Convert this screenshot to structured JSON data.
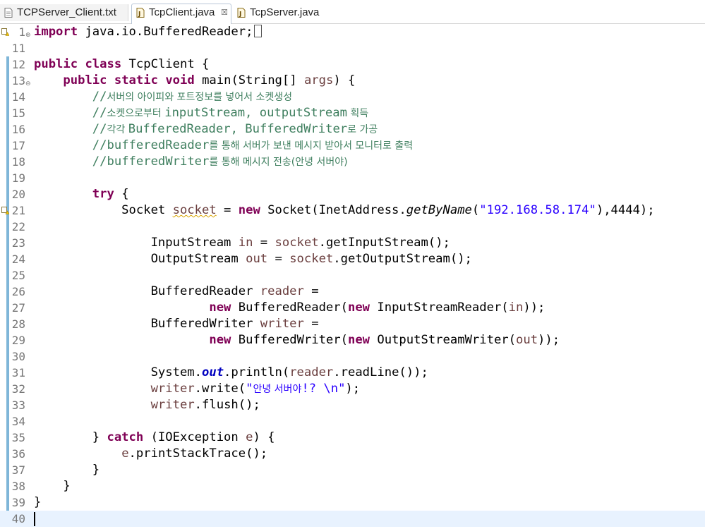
{
  "tabs": [
    {
      "label": "TCPServer_Client.txt",
      "icon": "text-file-icon",
      "active": false
    },
    {
      "label": "TcpClient.java",
      "icon": "java-file-icon",
      "active": true,
      "close": "☒"
    },
    {
      "label": "TcpServer.java",
      "icon": "java-file-icon",
      "active": false
    }
  ],
  "colors": {
    "keyword": "#7f0055",
    "comment": "#3f7f5f",
    "string": "#2a00ff",
    "local_var": "#6a3e3e",
    "field": "#0000c0",
    "current_line": "#e8f2fe",
    "quick_diff": "#7fb6d8"
  },
  "editor": {
    "lines": [
      {
        "n": "1",
        "fold": "⊕",
        "marker": "warning",
        "segs": [
          {
            "c": "kw",
            "t": "import"
          },
          {
            "c": "",
            "t": " java.io.BufferedReader;"
          }
        ],
        "box": true
      },
      {
        "n": "11",
        "segs": []
      },
      {
        "n": "12",
        "segs": [
          {
            "c": "kw",
            "t": "public"
          },
          {
            "c": "",
            "t": " "
          },
          {
            "c": "kw",
            "t": "class"
          },
          {
            "c": "",
            "t": " TcpClient {"
          }
        ]
      },
      {
        "n": "13",
        "fold": "⊖",
        "segs": [
          {
            "c": "",
            "t": "    "
          },
          {
            "c": "kw",
            "t": "public"
          },
          {
            "c": "",
            "t": " "
          },
          {
            "c": "kw",
            "t": "static"
          },
          {
            "c": "",
            "t": " "
          },
          {
            "c": "kw",
            "t": "void"
          },
          {
            "c": "",
            "t": " main(String[] "
          },
          {
            "c": "lv",
            "t": "args"
          },
          {
            "c": "",
            "t": ") {"
          }
        ]
      },
      {
        "n": "14",
        "segs": [
          {
            "c": "",
            "t": "        "
          },
          {
            "c": "cm",
            "t": "//"
          },
          {
            "c": "cmk",
            "t": "서버의 아이피와 포트정보를 넣어서 소켓생성"
          }
        ]
      },
      {
        "n": "15",
        "segs": [
          {
            "c": "",
            "t": "        "
          },
          {
            "c": "cm",
            "t": "//"
          },
          {
            "c": "cmk",
            "t": "소켓으로부터 "
          },
          {
            "c": "cm",
            "t": "inputStream, outputStream"
          },
          {
            "c": "cmk",
            "t": " 획득"
          }
        ]
      },
      {
        "n": "16",
        "segs": [
          {
            "c": "",
            "t": "        "
          },
          {
            "c": "cm",
            "t": "//"
          },
          {
            "c": "cmk",
            "t": "각각 "
          },
          {
            "c": "cm",
            "t": "BufferedReader, BufferedWriter"
          },
          {
            "c": "cmk",
            "t": "로 가공"
          }
        ]
      },
      {
        "n": "17",
        "segs": [
          {
            "c": "",
            "t": "        "
          },
          {
            "c": "cm",
            "t": "//bufferedReader"
          },
          {
            "c": "cmk",
            "t": "를 통해 서버가 보낸 메시지 받아서 모니터로 출력"
          }
        ]
      },
      {
        "n": "18",
        "segs": [
          {
            "c": "",
            "t": "        "
          },
          {
            "c": "cm",
            "t": "//bufferedWriter"
          },
          {
            "c": "cmk",
            "t": "를 통해 메시지 전송(안녕 서버야)"
          }
        ]
      },
      {
        "n": "19",
        "segs": []
      },
      {
        "n": "20",
        "segs": [
          {
            "c": "",
            "t": "        "
          },
          {
            "c": "kw",
            "t": "try"
          },
          {
            "c": "",
            "t": " {"
          }
        ]
      },
      {
        "n": "21",
        "marker": "warning",
        "segs": [
          {
            "c": "",
            "t": "            Socket "
          },
          {
            "c": "lv warn",
            "t": "socket"
          },
          {
            "c": "",
            "t": " = "
          },
          {
            "c": "kw",
            "t": "new"
          },
          {
            "c": "",
            "t": " Socket(InetAddress."
          },
          {
            "c": "it",
            "t": "getByName"
          },
          {
            "c": "",
            "t": "("
          },
          {
            "c": "st",
            "t": "\"192.168.58.174\""
          },
          {
            "c": "",
            "t": "),4444);"
          }
        ]
      },
      {
        "n": "22",
        "segs": []
      },
      {
        "n": "23",
        "segs": [
          {
            "c": "",
            "t": "                InputStream "
          },
          {
            "c": "lv",
            "t": "in"
          },
          {
            "c": "",
            "t": " = "
          },
          {
            "c": "lv",
            "t": "socket"
          },
          {
            "c": "",
            "t": ".getInputStream();"
          }
        ]
      },
      {
        "n": "24",
        "segs": [
          {
            "c": "",
            "t": "                OutputStream "
          },
          {
            "c": "lv",
            "t": "out"
          },
          {
            "c": "",
            "t": " = "
          },
          {
            "c": "lv",
            "t": "socket"
          },
          {
            "c": "",
            "t": ".getOutputStream();"
          }
        ]
      },
      {
        "n": "25",
        "segs": []
      },
      {
        "n": "26",
        "segs": [
          {
            "c": "",
            "t": "                BufferedReader "
          },
          {
            "c": "lv",
            "t": "reader"
          },
          {
            "c": "",
            "t": " ="
          }
        ]
      },
      {
        "n": "27",
        "segs": [
          {
            "c": "",
            "t": "                        "
          },
          {
            "c": "kw",
            "t": "new"
          },
          {
            "c": "",
            "t": " BufferedReader("
          },
          {
            "c": "kw",
            "t": "new"
          },
          {
            "c": "",
            "t": " InputStreamReader("
          },
          {
            "c": "lv",
            "t": "in"
          },
          {
            "c": "",
            "t": "));"
          }
        ]
      },
      {
        "n": "28",
        "segs": [
          {
            "c": "",
            "t": "                BufferedWriter "
          },
          {
            "c": "lv",
            "t": "writer"
          },
          {
            "c": "",
            "t": " ="
          }
        ]
      },
      {
        "n": "29",
        "segs": [
          {
            "c": "",
            "t": "                        "
          },
          {
            "c": "kw",
            "t": "new"
          },
          {
            "c": "",
            "t": " BufferedWriter("
          },
          {
            "c": "kw",
            "t": "new"
          },
          {
            "c": "",
            "t": " OutputStreamWriter("
          },
          {
            "c": "lv",
            "t": "out"
          },
          {
            "c": "",
            "t": "));"
          }
        ]
      },
      {
        "n": "30",
        "segs": []
      },
      {
        "n": "31",
        "segs": [
          {
            "c": "",
            "t": "                System."
          },
          {
            "c": "fld",
            "t": "out"
          },
          {
            "c": "",
            "t": ".println("
          },
          {
            "c": "lv",
            "t": "reader"
          },
          {
            "c": "",
            "t": ".readLine());"
          }
        ]
      },
      {
        "n": "32",
        "segs": [
          {
            "c": "",
            "t": "                "
          },
          {
            "c": "lv",
            "t": "writer"
          },
          {
            "c": "",
            "t": ".write("
          },
          {
            "c": "st",
            "t": "\""
          },
          {
            "c": "stk",
            "t": "안녕 서버야"
          },
          {
            "c": "st",
            "t": "!? \\n\""
          },
          {
            "c": "",
            "t": ");"
          }
        ]
      },
      {
        "n": "33",
        "segs": [
          {
            "c": "",
            "t": "                "
          },
          {
            "c": "lv",
            "t": "writer"
          },
          {
            "c": "",
            "t": ".flush();"
          }
        ]
      },
      {
        "n": "34",
        "segs": []
      },
      {
        "n": "35",
        "segs": [
          {
            "c": "",
            "t": "        } "
          },
          {
            "c": "kw",
            "t": "catch"
          },
          {
            "c": "",
            "t": " (IOException "
          },
          {
            "c": "lv",
            "t": "e"
          },
          {
            "c": "",
            "t": ") {"
          }
        ]
      },
      {
        "n": "36",
        "segs": [
          {
            "c": "",
            "t": "            "
          },
          {
            "c": "lv",
            "t": "e"
          },
          {
            "c": "",
            "t": ".printStackTrace();"
          }
        ]
      },
      {
        "n": "37",
        "segs": [
          {
            "c": "",
            "t": "        }"
          }
        ]
      },
      {
        "n": "38",
        "segs": [
          {
            "c": "",
            "t": "    }"
          }
        ]
      },
      {
        "n": "39",
        "segs": [
          {
            "c": "",
            "t": "}"
          }
        ]
      },
      {
        "n": "40",
        "current": true,
        "segs": []
      }
    ]
  }
}
